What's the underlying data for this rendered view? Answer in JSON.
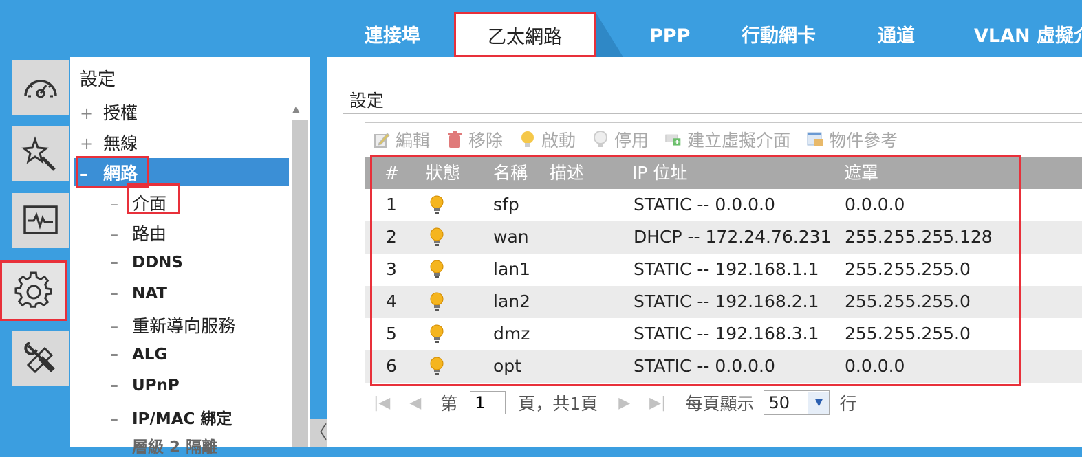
{
  "tabs": [
    {
      "label": "連接埠"
    },
    {
      "label": "乙太網路"
    },
    {
      "label": "PPP"
    },
    {
      "label": "行動網卡"
    },
    {
      "label": "通道"
    },
    {
      "label": "VLAN 虛擬介"
    }
  ],
  "icons": [
    "dashboard-icon",
    "wizard-icon",
    "monitor-icon",
    "settings-icon",
    "maintenance-icon"
  ],
  "menu": {
    "title": "設定",
    "items": [
      {
        "sym": "+",
        "label": "授權"
      },
      {
        "sym": "+",
        "label": "無線"
      },
      {
        "sym": "–",
        "label": "網路"
      },
      {
        "sym": "–",
        "label": "介面"
      },
      {
        "sym": "–",
        "label": "路由"
      },
      {
        "sym": "–",
        "label": "DDNS"
      },
      {
        "sym": "–",
        "label": "NAT"
      },
      {
        "sym": "–",
        "label": "重新導向服務"
      },
      {
        "sym": "–",
        "label": "ALG"
      },
      {
        "sym": "–",
        "label": "UPnP"
      },
      {
        "sym": "–",
        "label": "IP/MAC 綁定"
      },
      {
        "sym": "",
        "label": "層級 2 隔離"
      }
    ],
    "collapse": "〈"
  },
  "main": {
    "section_title": "設定",
    "toolbar": {
      "edit": "編輯",
      "remove": "移除",
      "activate": "啟動",
      "deactivate": "停用",
      "create_virtual": "建立虛擬介面",
      "object_ref": "物件參考"
    },
    "columns": [
      "#",
      "狀態",
      "名稱",
      "描述",
      "IP 位址",
      "遮罩"
    ],
    "rows": [
      {
        "num": "1",
        "name": "sfp",
        "ip": "STATIC -- 0.0.0.0",
        "mask": "0.0.0.0"
      },
      {
        "num": "2",
        "name": "wan",
        "ip": "DHCP -- 172.24.76.231",
        "mask": "255.255.255.128"
      },
      {
        "num": "3",
        "name": "lan1",
        "ip": "STATIC -- 192.168.1.1",
        "mask": "255.255.255.0"
      },
      {
        "num": "4",
        "name": "lan2",
        "ip": "STATIC -- 192.168.2.1",
        "mask": "255.255.255.0"
      },
      {
        "num": "5",
        "name": "dmz",
        "ip": "STATIC -- 192.168.3.1",
        "mask": "255.255.255.0"
      },
      {
        "num": "6",
        "name": "opt",
        "ip": "STATIC -- 0.0.0.0",
        "mask": "0.0.0.0"
      }
    ],
    "pager": {
      "page_prefix": "第",
      "page_value": "1",
      "page_suffix": "頁，共1頁",
      "per_page_label": "每頁顯示",
      "per_page_value": "50",
      "rows_unit": "行"
    }
  },
  "colors": {
    "accent": "#3b9ee0",
    "highlight": "#e8303a",
    "selected": "#3b8fd6"
  }
}
